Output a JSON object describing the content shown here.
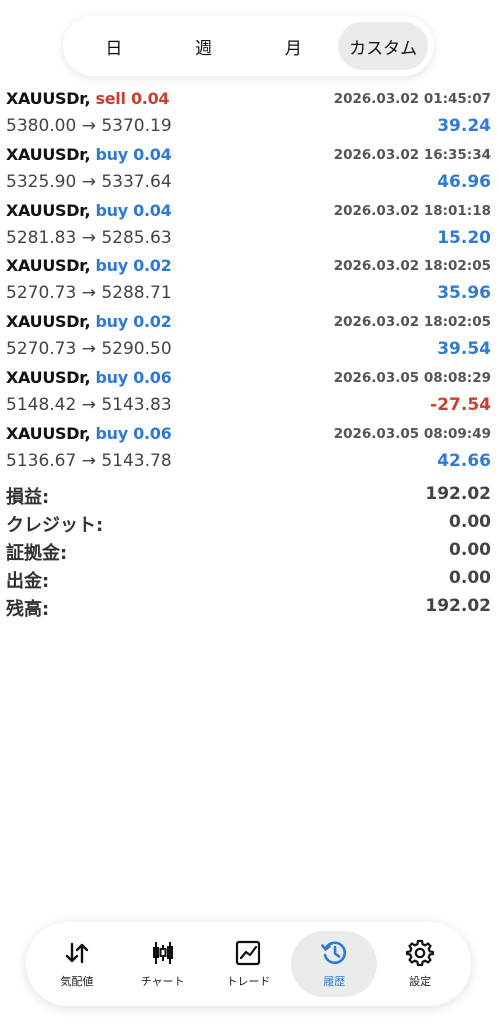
{
  "period_tabs": [
    {
      "label": "日"
    },
    {
      "label": "週"
    },
    {
      "label": "月"
    },
    {
      "label": "カスタム",
      "active": true
    }
  ],
  "deals": [
    {
      "symbol": "XAUUSDr,",
      "type": "sell",
      "volume": "0.04",
      "time": "2026.03.02 01:45:07",
      "prices": "5380.00 → 5370.19",
      "profit": "39.24",
      "positive": true
    },
    {
      "symbol": "XAUUSDr,",
      "type": "buy",
      "volume": "0.04",
      "time": "2026.03.02 16:35:34",
      "prices": "5325.90 → 5337.64",
      "profit": "46.96",
      "positive": true
    },
    {
      "symbol": "XAUUSDr,",
      "type": "buy",
      "volume": "0.04",
      "time": "2026.03.02 18:01:18",
      "prices": "5281.83 → 5285.63",
      "profit": "15.20",
      "positive": true
    },
    {
      "symbol": "XAUUSDr,",
      "type": "buy",
      "volume": "0.02",
      "time": "2026.03.02 18:02:05",
      "prices": "5270.73 → 5288.71",
      "profit": "35.96",
      "positive": true
    },
    {
      "symbol": "XAUUSDr,",
      "type": "buy",
      "volume": "0.02",
      "time": "2026.03.02 18:02:05",
      "prices": "5270.73 → 5290.50",
      "profit": "39.54",
      "positive": true
    },
    {
      "symbol": "XAUUSDr,",
      "type": "buy",
      "volume": "0.06",
      "time": "2026.03.05 08:08:29",
      "prices": "5148.42 → 5143.83",
      "profit": "-27.54",
      "positive": false
    },
    {
      "symbol": "XAUUSDr,",
      "type": "buy",
      "volume": "0.06",
      "time": "2026.03.05 08:09:49",
      "prices": "5136.67 → 5143.78",
      "profit": "42.66",
      "positive": true
    }
  ],
  "summary": [
    {
      "label": "損益:",
      "value": "192.02"
    },
    {
      "label": "クレジット:",
      "value": "0.00"
    },
    {
      "label": "証拠金:",
      "value": "0.00"
    },
    {
      "label": "出金:",
      "value": "0.00"
    },
    {
      "label": "残高:",
      "value": "192.02"
    }
  ],
  "nav": [
    {
      "label": "気配値",
      "icon": "quotes-arrows-icon"
    },
    {
      "label": "チャート",
      "icon": "candlestick-chart-icon"
    },
    {
      "label": "トレード",
      "icon": "trade-chart-icon"
    },
    {
      "label": "履歴",
      "icon": "history-clock-icon",
      "active": true
    },
    {
      "label": "設定",
      "icon": "gear-icon"
    }
  ],
  "colors": {
    "buy": "#2f7bd3",
    "sell": "#c8402f",
    "positive": "#2f7bd3",
    "negative": "#c8402f",
    "active_nav": "#2f7bd3"
  }
}
